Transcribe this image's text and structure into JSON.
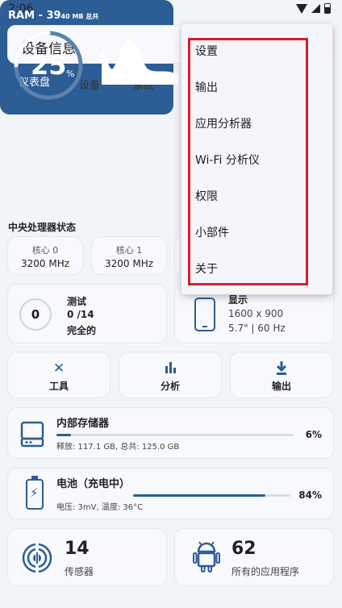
{
  "status_bar": {
    "time": "2:06"
  },
  "header": {
    "title": "设备信息"
  },
  "tabs": [
    {
      "label": "仪表盘",
      "active": true
    },
    {
      "label": "设备",
      "active": false
    },
    {
      "label": "系统",
      "active": false
    }
  ],
  "ram": {
    "label": "RAM - 39",
    "total_suffix": "40 MB 总共",
    "percent": "25",
    "percent_sign": "%",
    "usage_fraction": 0.25
  },
  "cpu": {
    "title": "中央处理器状态",
    "cores": [
      {
        "label": "核心 0",
        "value": "3200 MHz"
      },
      {
        "label": "核心 1",
        "value": "3200 MHz"
      }
    ]
  },
  "tests": {
    "count": "0",
    "title": "测试",
    "progress": "0 /14",
    "status": "完全的"
  },
  "display": {
    "title": "显示",
    "resolution": "1600 x 900",
    "size": "5.7\" | 60 Hz"
  },
  "tools": [
    {
      "label": "工具",
      "icon": "tools-icon"
    },
    {
      "label": "分析",
      "icon": "bar-chart-icon"
    },
    {
      "label": "输出",
      "icon": "download-icon"
    }
  ],
  "storage": {
    "title": "内部存储器",
    "details": "释放: 117.1 GB,  总共: 125.0 GB",
    "percent": "6%",
    "fraction": 0.06
  },
  "battery": {
    "title": "电池（充电中）",
    "details": "电压: 3mV,  温度: 36°C",
    "percent": "84%",
    "fraction": 0.84
  },
  "sensors": {
    "count": "14",
    "label": "传感器"
  },
  "apps": {
    "count": "62",
    "label": "所有的应用程序"
  },
  "menu": {
    "items": [
      "设置",
      "输出",
      "应用分析器",
      "Wi-Fi 分析仪",
      "权限",
      "小部件",
      "关于"
    ]
  },
  "colors": {
    "accent": "#2c5d94",
    "highlight": "#d61d2a"
  }
}
